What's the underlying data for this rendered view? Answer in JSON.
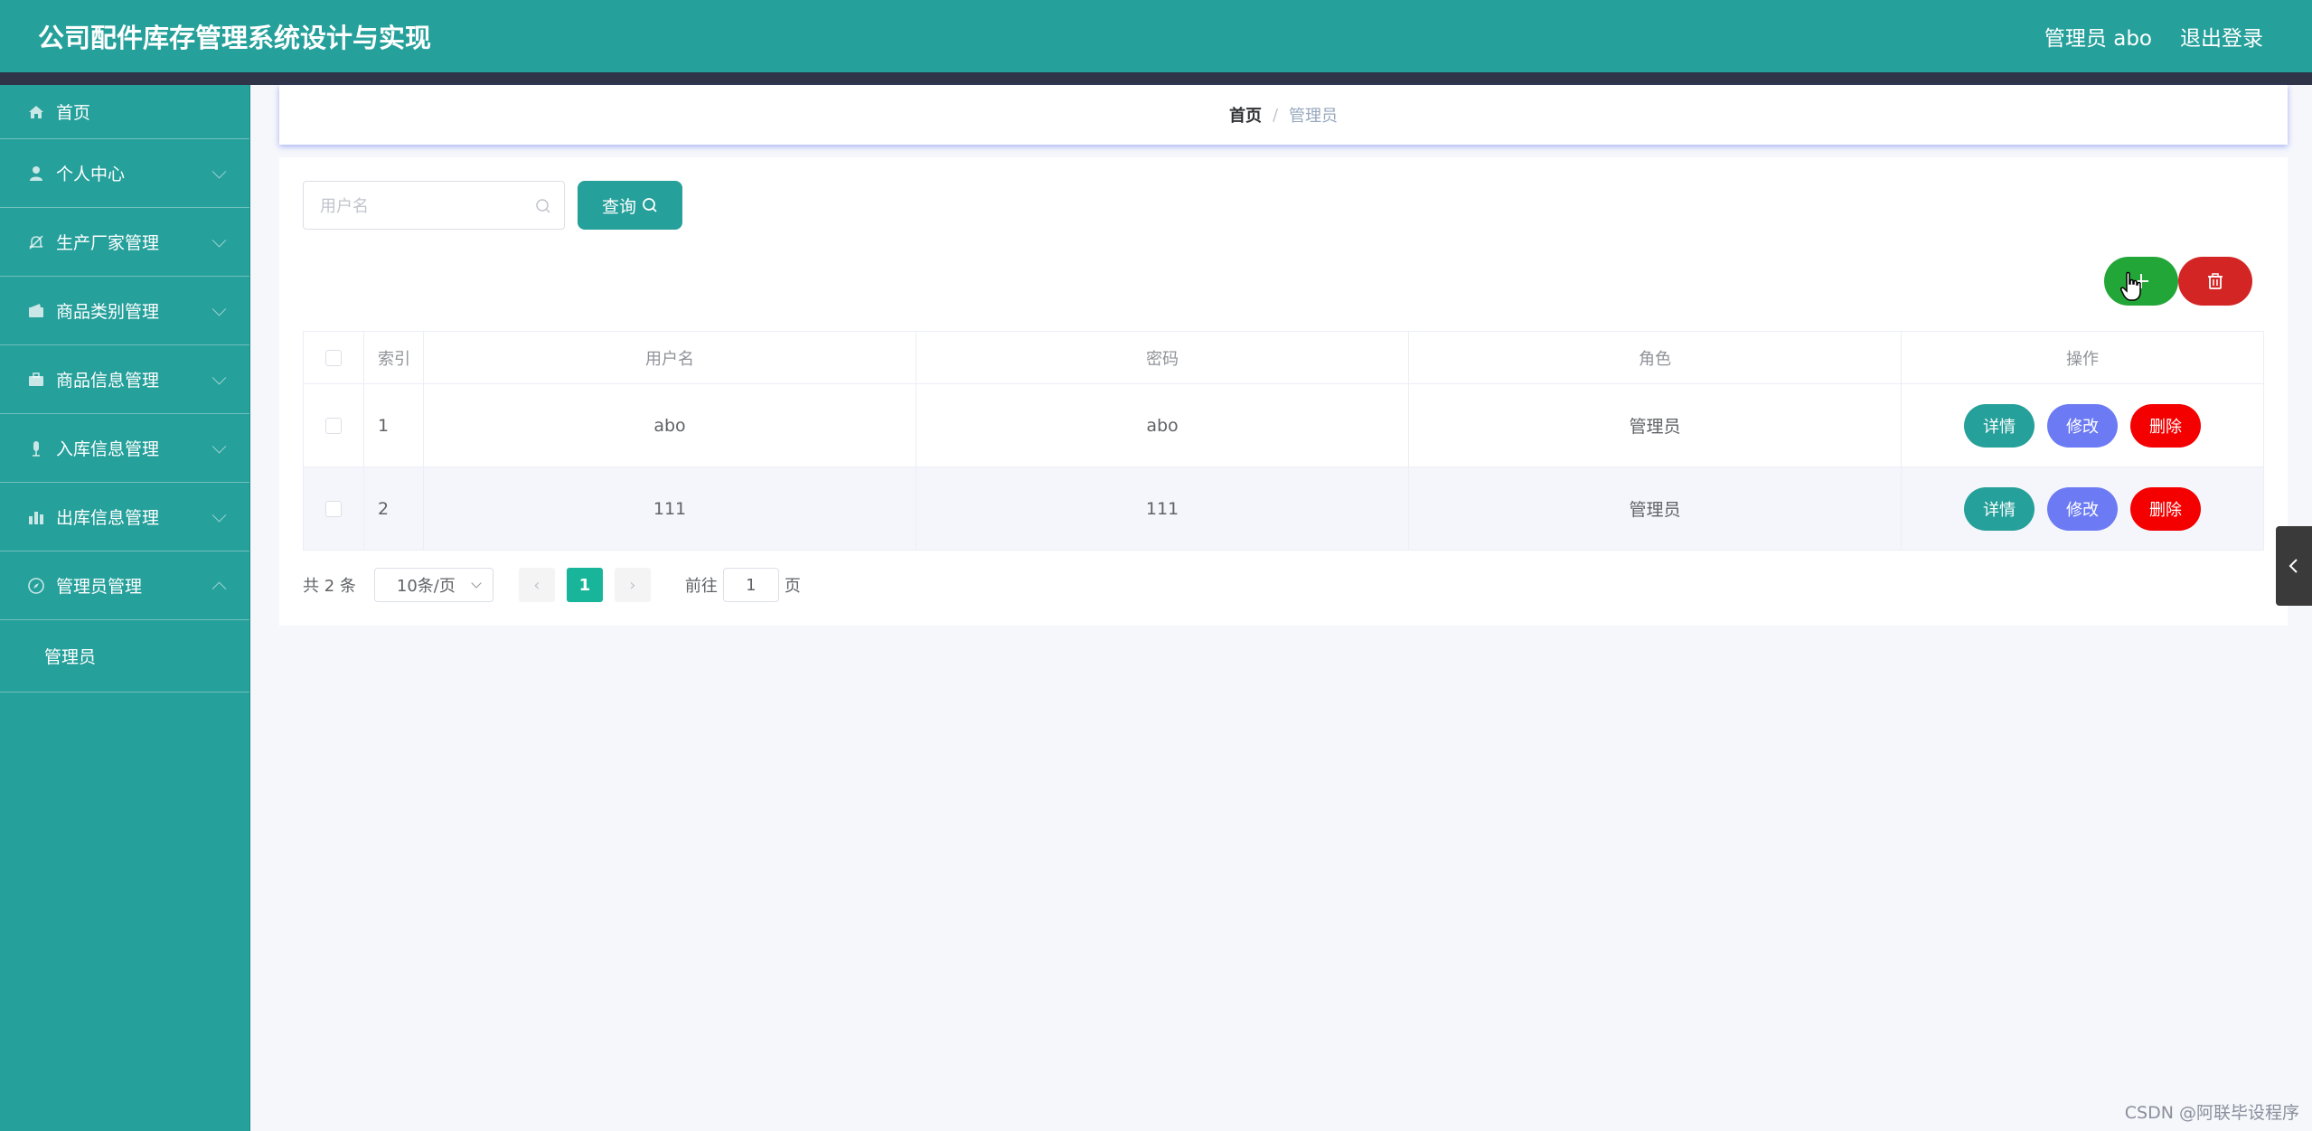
{
  "header": {
    "title": "公司配件库存管理系统设计与实现",
    "user": "管理员 abo",
    "logout": "退出登录"
  },
  "sidebar": {
    "items": [
      {
        "label": "首页",
        "icon": "home-icon"
      },
      {
        "label": "个人中心",
        "icon": "user-icon"
      },
      {
        "label": "生产厂家管理",
        "icon": "bell-off-icon"
      },
      {
        "label": "商品类别管理",
        "icon": "wallet-icon"
      },
      {
        "label": "商品信息管理",
        "icon": "briefcase-icon"
      },
      {
        "label": "入库信息管理",
        "icon": "microphone-icon"
      },
      {
        "label": "出库信息管理",
        "icon": "bar-chart-icon"
      },
      {
        "label": "管理员管理",
        "icon": "compass-icon"
      }
    ],
    "subitem": "管理员"
  },
  "breadcrumb": {
    "home": "首页",
    "separator": "/",
    "current": "管理员"
  },
  "search": {
    "placeholder": "用户名",
    "button": "查询"
  },
  "table": {
    "headers": {
      "index": "索引",
      "username": "用户名",
      "password": "密码",
      "role": "角色",
      "actions": "操作"
    },
    "rows": [
      {
        "index": "1",
        "username": "abo",
        "password": "abo",
        "role": "管理员"
      },
      {
        "index": "2",
        "username": "111",
        "password": "111",
        "role": "管理员"
      }
    ],
    "actions": {
      "detail": "详情",
      "edit": "修改",
      "delete": "删除"
    }
  },
  "pagination": {
    "total": "共 2 条",
    "page_size": "10条/页",
    "current_page": "1",
    "goto_prefix": "前往",
    "goto_value": "1",
    "goto_suffix": "页"
  },
  "watermark": "CSDN @阿联毕设程序",
  "colors": {
    "primary": "#26a09b",
    "header_dark": "#2f3448",
    "add": "#23a638",
    "delete": "#d42525",
    "edit": "#6c7bf4",
    "row_delete": "#f40000",
    "page_active": "#18b59a"
  }
}
